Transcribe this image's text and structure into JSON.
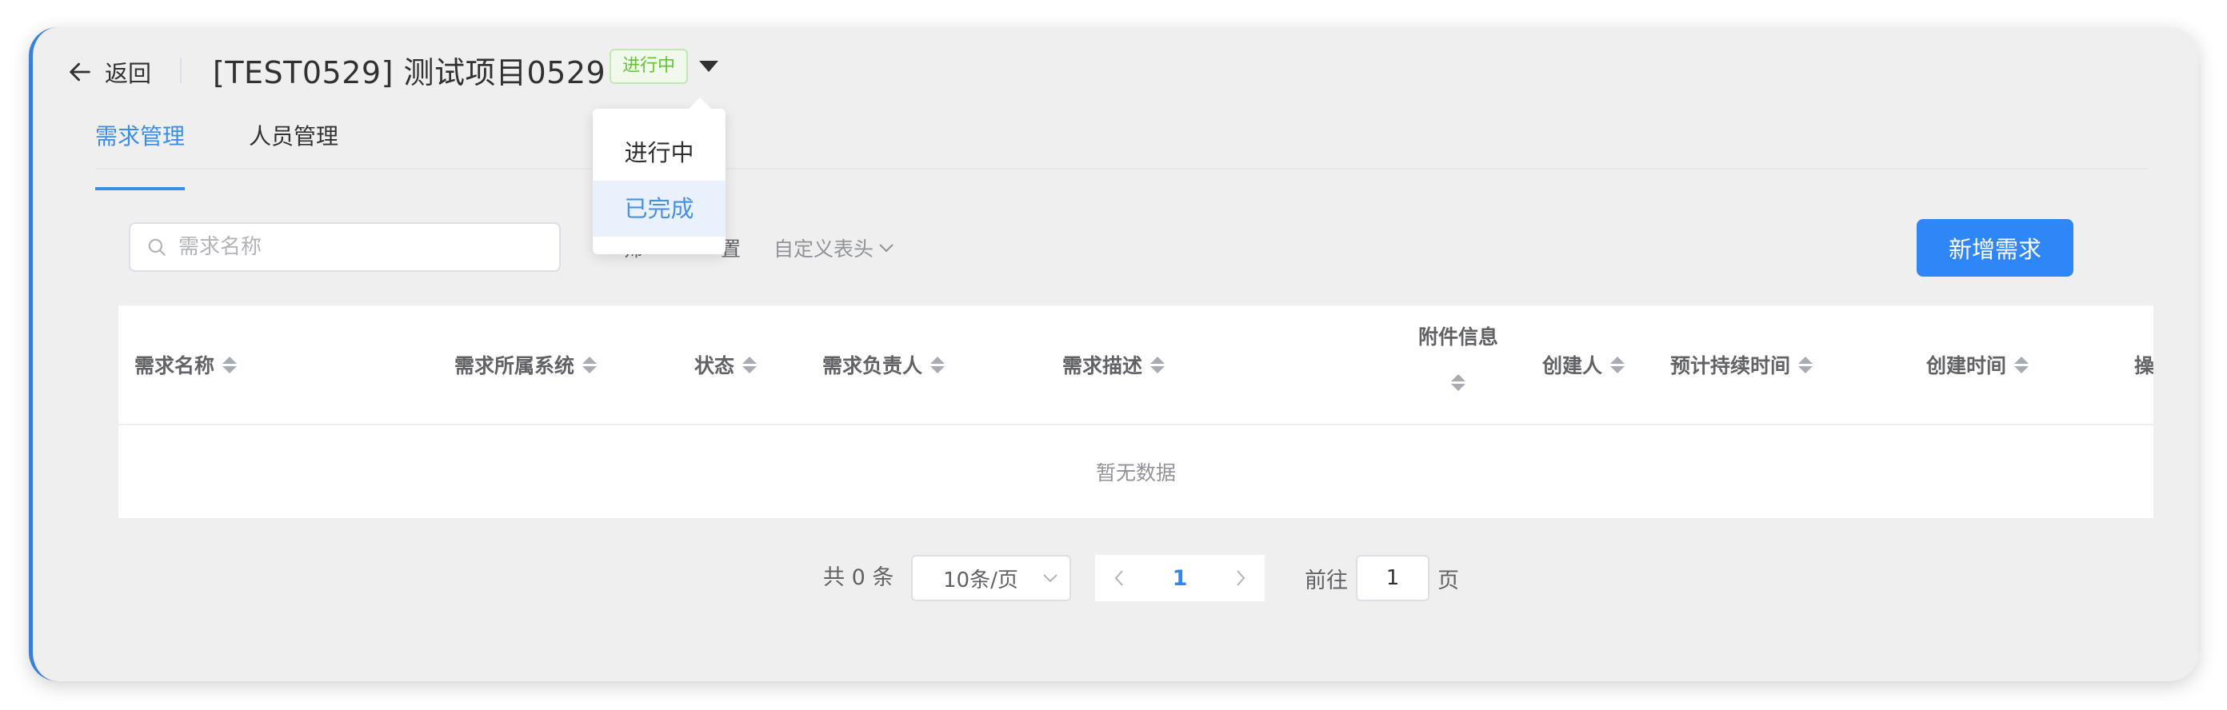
{
  "header": {
    "back_label": "返回",
    "title": "[TEST0529] 测试项目0529",
    "status_badge": "进行中"
  },
  "status_dropdown": {
    "options": [
      "进行中",
      "已完成"
    ],
    "highlighted": "已完成"
  },
  "tabs": [
    {
      "label": "需求管理",
      "active": true
    },
    {
      "label": "人员管理",
      "active": false
    }
  ],
  "toolbar": {
    "search_placeholder": "需求名称",
    "partial_button_1": "筛",
    "partial_button_2": "置",
    "custom_header_label": "自定义表头",
    "add_button": "新增需求"
  },
  "table": {
    "columns": [
      "需求名称",
      "需求所属系统",
      "状态",
      "需求负责人",
      "需求描述",
      "附件信息",
      "创建人",
      "预计持续时间",
      "创建时间",
      "操"
    ],
    "empty_text": "暂无数据"
  },
  "pagination": {
    "total_text": "共 0 条",
    "page_size": "10条/页",
    "current_page": "1",
    "goto_prefix": "前往",
    "goto_value": "1",
    "goto_suffix": "页"
  },
  "colors": {
    "primary": "#2f86f6",
    "success_text": "#67c23a",
    "card_bg": "#efefef"
  },
  "icons": [
    "arrow-left-icon",
    "caret-down-icon",
    "search-icon",
    "chevron-down-icon",
    "sort-icon",
    "chevron-left-icon",
    "chevron-right-icon"
  ]
}
